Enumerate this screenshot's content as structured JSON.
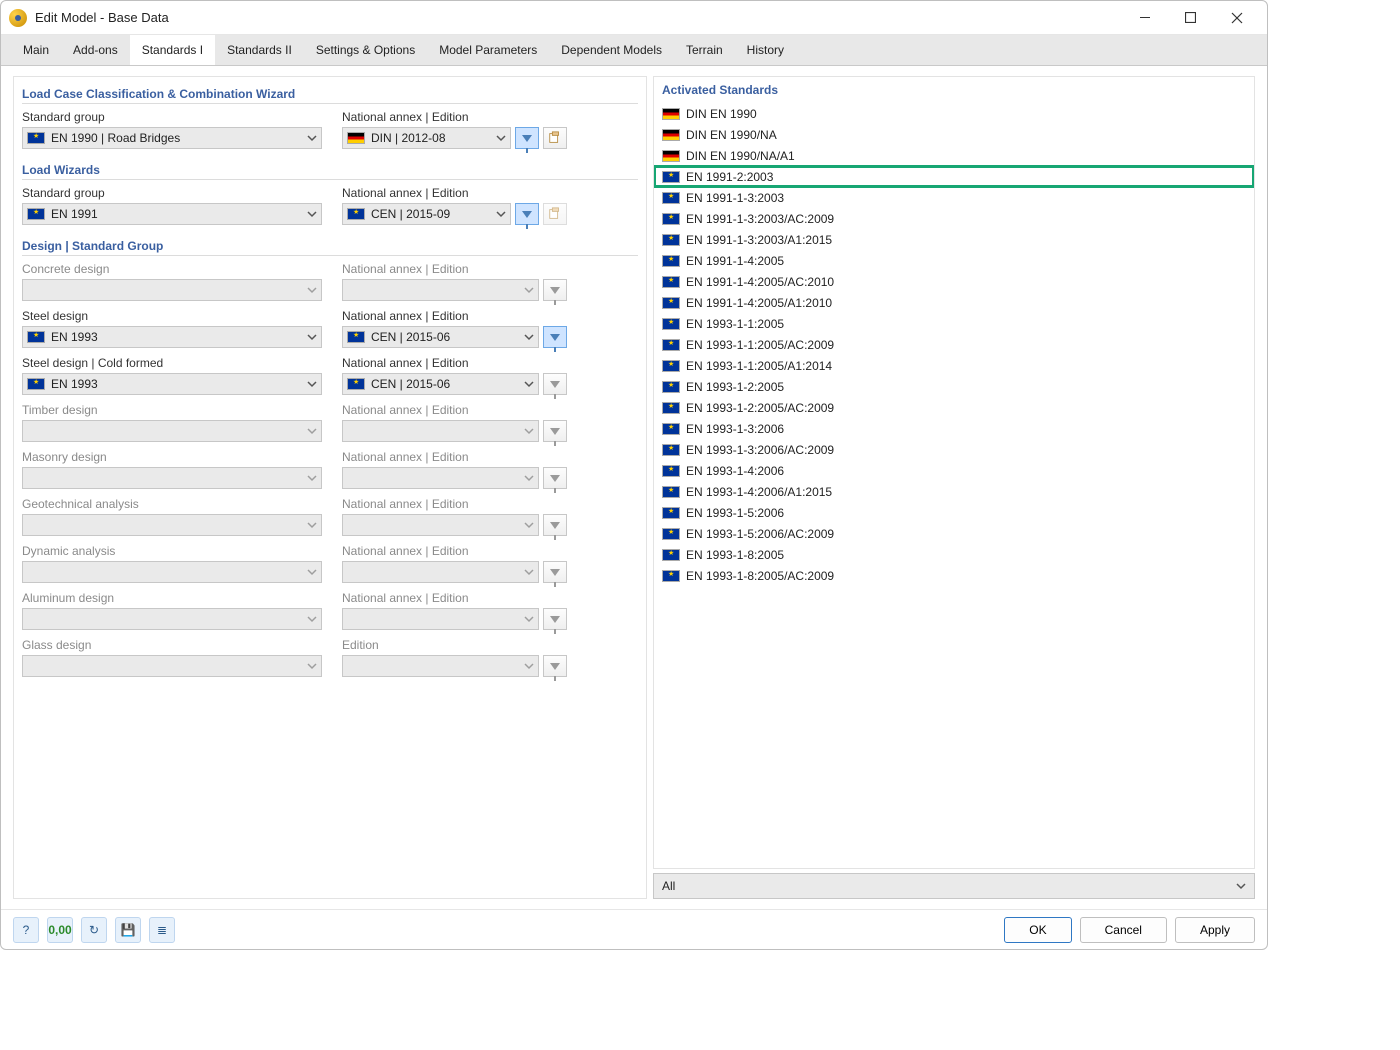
{
  "window_title": "Edit Model - Base Data",
  "tabs": [
    "Main",
    "Add-ons",
    "Standards I",
    "Standards II",
    "Settings & Options",
    "Model Parameters",
    "Dependent Models",
    "Terrain",
    "History"
  ],
  "active_tab": 2,
  "left": {
    "section1_title": "Load Case Classification & Combination Wizard",
    "section2_title": "Load Wizards",
    "section3_title": "Design | Standard Group",
    "label_sg": "Standard group",
    "label_nae": "National annex | Edition",
    "label_ed": "Edition",
    "s1_sg": "EN 1990 | Road Bridges",
    "s1_nae": "DIN | 2012-08",
    "s2_sg": "EN 1991",
    "s2_nae": "CEN | 2015-09",
    "rows": [
      {
        "label": "Concrete design",
        "enabled": false,
        "nae_label": "National annex | Edition",
        "sg": "",
        "nae": ""
      },
      {
        "label": "Steel design",
        "enabled": true,
        "nae_label": "National annex | Edition",
        "sg": "EN 1993",
        "nae": "CEN | 2015-06"
      },
      {
        "label": "Steel design | Cold formed",
        "enabled": true,
        "nae_label": "National annex | Edition",
        "sg": "EN 1993",
        "nae": "CEN | 2015-06"
      },
      {
        "label": "Timber design",
        "enabled": false,
        "nae_label": "National annex | Edition",
        "sg": "",
        "nae": ""
      },
      {
        "label": "Masonry design",
        "enabled": false,
        "nae_label": "National annex | Edition",
        "sg": "",
        "nae": ""
      },
      {
        "label": "Geotechnical analysis",
        "enabled": false,
        "nae_label": "National annex | Edition",
        "sg": "",
        "nae": ""
      },
      {
        "label": "Dynamic analysis",
        "enabled": false,
        "nae_label": "National annex | Edition",
        "sg": "",
        "nae": ""
      },
      {
        "label": "Aluminum design",
        "enabled": false,
        "nae_label": "National annex | Edition",
        "sg": "",
        "nae": ""
      },
      {
        "label": "Glass design",
        "enabled": false,
        "nae_label": "Edition",
        "sg": "",
        "nae": ""
      }
    ]
  },
  "right": {
    "title": "Activated Standards",
    "items": [
      {
        "flag": "de",
        "text": "DIN EN 1990",
        "hl": false
      },
      {
        "flag": "de",
        "text": "DIN EN 1990/NA",
        "hl": false
      },
      {
        "flag": "de",
        "text": "DIN EN 1990/NA/A1",
        "hl": false
      },
      {
        "flag": "eu",
        "text": "EN 1991-2:2003",
        "hl": true
      },
      {
        "flag": "eu",
        "text": "EN 1991-1-3:2003",
        "hl": false
      },
      {
        "flag": "eu",
        "text": "EN 1991-1-3:2003/AC:2009",
        "hl": false
      },
      {
        "flag": "eu",
        "text": "EN 1991-1-3:2003/A1:2015",
        "hl": false
      },
      {
        "flag": "eu",
        "text": "EN 1991-1-4:2005",
        "hl": false
      },
      {
        "flag": "eu",
        "text": "EN 1991-1-4:2005/AC:2010",
        "hl": false
      },
      {
        "flag": "eu",
        "text": "EN 1991-1-4:2005/A1:2010",
        "hl": false
      },
      {
        "flag": "eu",
        "text": "EN 1993-1-1:2005",
        "hl": false
      },
      {
        "flag": "eu",
        "text": "EN 1993-1-1:2005/AC:2009",
        "hl": false
      },
      {
        "flag": "eu",
        "text": "EN 1993-1-1:2005/A1:2014",
        "hl": false
      },
      {
        "flag": "eu",
        "text": "EN 1993-1-2:2005",
        "hl": false
      },
      {
        "flag": "eu",
        "text": "EN 1993-1-2:2005/AC:2009",
        "hl": false
      },
      {
        "flag": "eu",
        "text": "EN 1993-1-3:2006",
        "hl": false
      },
      {
        "flag": "eu",
        "text": "EN 1993-1-3:2006/AC:2009",
        "hl": false
      },
      {
        "flag": "eu",
        "text": "EN 1993-1-4:2006",
        "hl": false
      },
      {
        "flag": "eu",
        "text": "EN 1993-1-4:2006/A1:2015",
        "hl": false
      },
      {
        "flag": "eu",
        "text": "EN 1993-1-5:2006",
        "hl": false
      },
      {
        "flag": "eu",
        "text": "EN 1993-1-5:2006/AC:2009",
        "hl": false
      },
      {
        "flag": "eu",
        "text": "EN 1993-1-8:2005",
        "hl": false
      },
      {
        "flag": "eu",
        "text": "EN 1993-1-8:2005/AC:2009",
        "hl": false
      }
    ],
    "filter": "All"
  },
  "buttons": {
    "ok": "OK",
    "cancel": "Cancel",
    "apply": "Apply"
  }
}
